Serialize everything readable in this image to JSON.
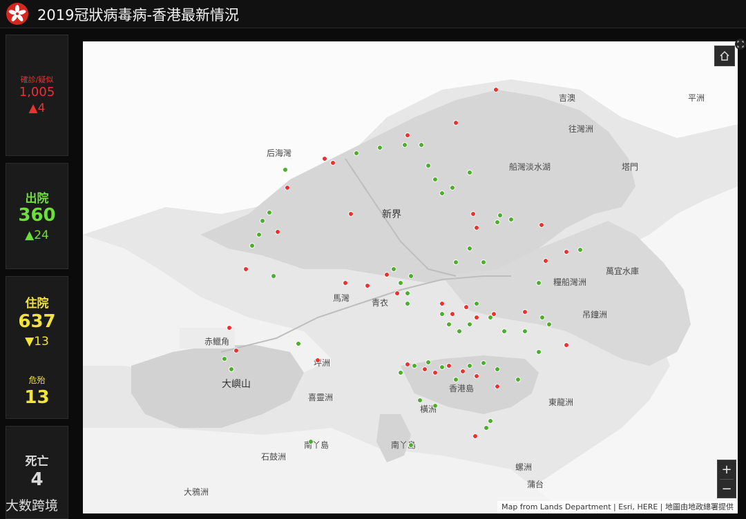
{
  "header": {
    "title": "2019冠狀病毒病-香港最新情況",
    "emblem_icon": "hksar-bauhinia-emblem"
  },
  "stats": {
    "confirmed": {
      "label": "確診/疑似",
      "value": "1,005",
      "delta": "▲4",
      "color": "#e8332f"
    },
    "discharged": {
      "label": "出院",
      "value": "360",
      "delta": "▲24",
      "color": "#6ede3b"
    },
    "hospitalised": {
      "label": "住院",
      "value": "637",
      "delta": "▼13",
      "color": "#f2e43a"
    },
    "critical": {
      "label": "危殆",
      "value": "13",
      "color": "#f2e43a"
    },
    "deaths": {
      "label": "死亡",
      "value": "4",
      "color": "#d9d9d9"
    }
  },
  "map": {
    "places": [
      "后海灣",
      "吉澳",
      "平洲",
      "往灣洲",
      "船灣淡水湖",
      "塔門",
      "新界",
      "馬灣",
      "青衣",
      "赤鱲角",
      "大嶼山",
      "坪洲",
      "喜靈洲",
      "石鼓洲",
      "大鴉洲",
      "南丫島",
      "南丫島",
      "香港島",
      "橫洲",
      "糧船灣洲",
      "吊鐘洲",
      "東龍洲",
      "螺洲",
      "蒲台",
      "萬宜水庫"
    ],
    "attribution": "Map from Lands Department | Esri, HERE | 地圖由地政總署提供",
    "home_icon": "home-icon",
    "zoom_in_label": "+",
    "zoom_out_label": "−",
    "legend_colors": {
      "active_case": "#e8332f",
      "recovered_case": "#4caf2a"
    }
  },
  "watermark": "大数跨境"
}
